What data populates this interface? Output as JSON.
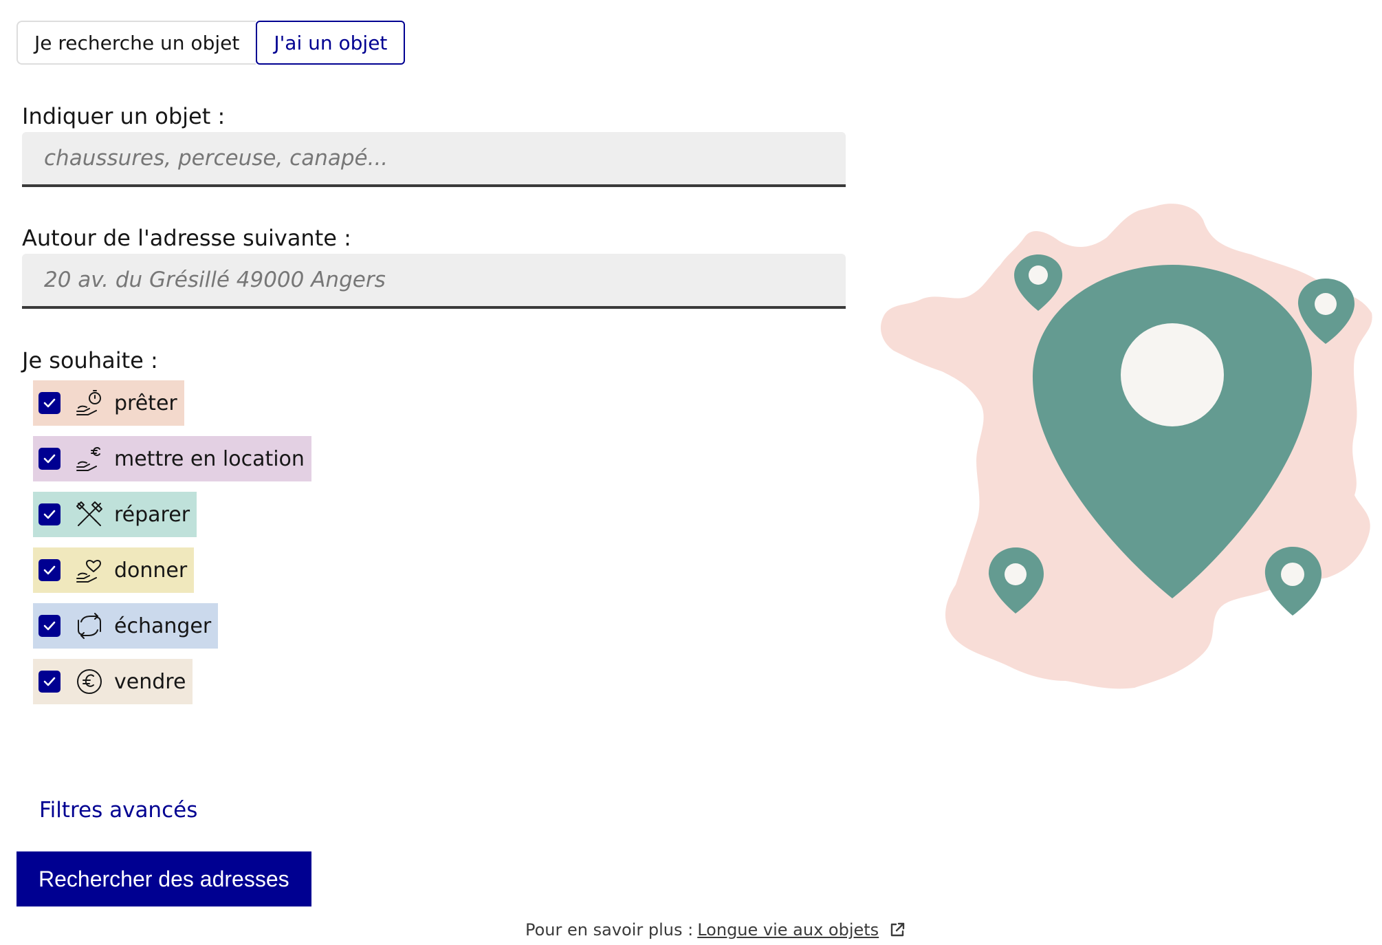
{
  "tabs": [
    {
      "label": "Je recherche un objet",
      "active": false
    },
    {
      "label": "J'ai un objet",
      "active": true
    }
  ],
  "object_field": {
    "label": "Indiquer un objet :",
    "placeholder": "chaussures, perceuse, canapé...",
    "value": ""
  },
  "address_field": {
    "label": "Autour de l'adresse suivante :",
    "placeholder": "20 av. du Grésillé 49000 Angers",
    "value": ""
  },
  "actions": {
    "label": "Je souhaite :",
    "options": [
      {
        "label": "prêter",
        "checked": true,
        "icon": "lend-clock-icon",
        "color": "#f3d9cc"
      },
      {
        "label": "mettre en location",
        "checked": true,
        "icon": "rent-euro-icon",
        "color": "#e3d0e3"
      },
      {
        "label": "réparer",
        "checked": true,
        "icon": "repair-tools-icon",
        "color": "#bfe1da"
      },
      {
        "label": "donner",
        "checked": true,
        "icon": "give-heart-icon",
        "color": "#f0e8bd"
      },
      {
        "label": "échanger",
        "checked": true,
        "icon": "exchange-arrows-icon",
        "color": "#cbd9ec"
      },
      {
        "label": "vendre",
        "checked": true,
        "icon": "euro-coin-icon",
        "color": "#f1e8dc"
      }
    ]
  },
  "advanced_filters_label": "Filtres avancés",
  "search_button_label": "Rechercher des adresses",
  "footer": {
    "prefix": "Pour en savoir plus :",
    "link_label": "Longue vie aux objets"
  },
  "colors": {
    "primary": "#000091",
    "map_fill": "#f8ddd7",
    "pin": "#649b91",
    "pin_hole": "#f7f5f2"
  }
}
